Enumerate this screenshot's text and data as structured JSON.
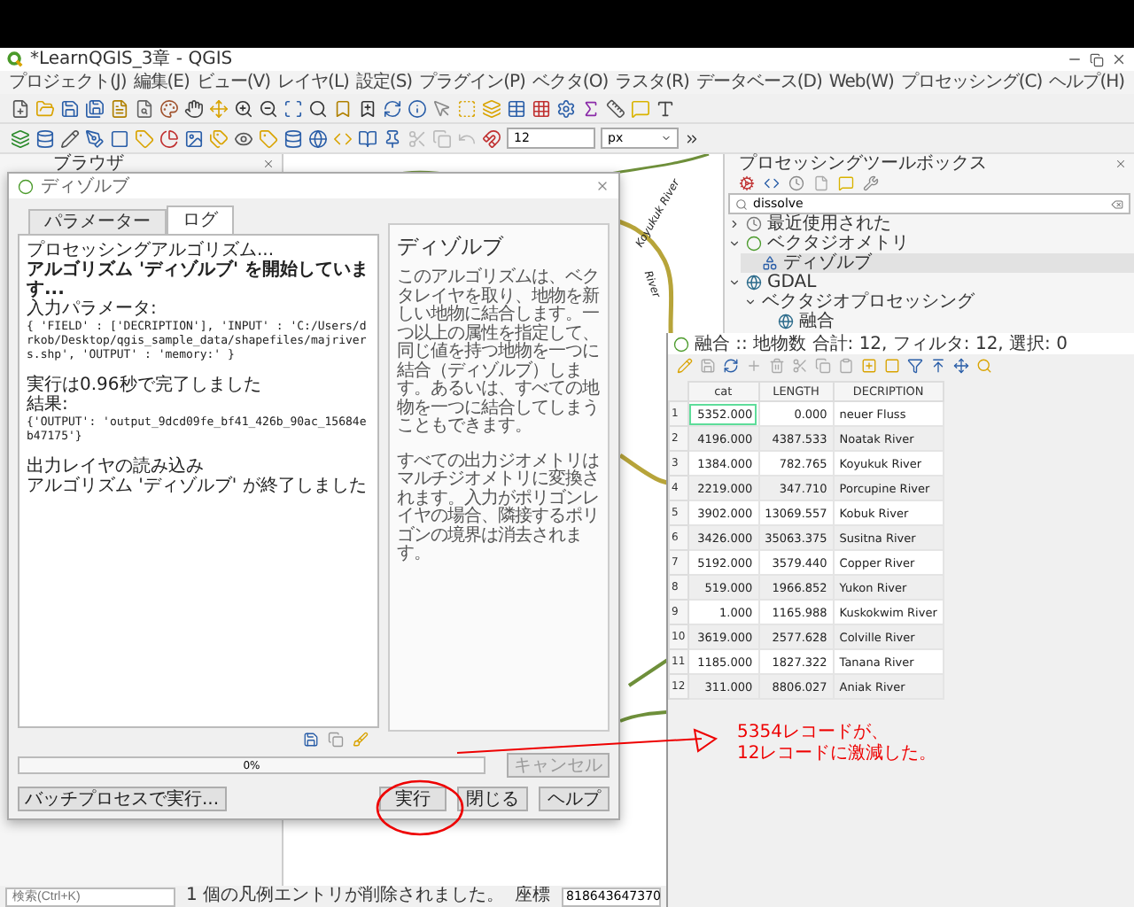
{
  "window": {
    "title": "*LearnQGIS_3章 - QGIS"
  },
  "menu": [
    "プロジェクト(J)",
    "編集(E)",
    "ビュー(V)",
    "レイヤ(L)",
    "設定(S)",
    "プラグイン(P)",
    "ベクタ(O)",
    "ラスタ(R)",
    "データベース(D)",
    "Web(W)",
    "プロセッシング(C)",
    "ヘルプ(H)"
  ],
  "toolbar_font": {
    "size": "12",
    "unit": "px"
  },
  "browser_panel": {
    "title": "ブラウザ"
  },
  "map": {
    "labels": [
      "Koyukuk River",
      "River"
    ]
  },
  "dialog": {
    "title": "ディゾルブ",
    "tabs": [
      {
        "label": "パラメーター",
        "selected": false
      },
      {
        "label": "ログ",
        "selected": true
      }
    ],
    "log": [
      {
        "kind": "text",
        "text": "プロセッシングアルゴリズム...",
        "gap": false
      },
      {
        "kind": "bold",
        "text": "アルゴリズム 'ディゾルブ' を開始しています...",
        "gap": false
      },
      {
        "kind": "text",
        "text": "入力パラメータ:",
        "gap": false
      },
      {
        "kind": "code",
        "text": "{ 'FIELD' : ['DECRIPTION'], 'INPUT' : 'C:/Users/drkob/Desktop/qgis_sample_data/shapefiles/majrivers.shp', 'OUTPUT' : 'memory:' }",
        "gap": false
      },
      {
        "kind": "text",
        "text": "実行は0.96秒で完了しました",
        "gap": true
      },
      {
        "kind": "text",
        "text": "結果:",
        "gap": false
      },
      {
        "kind": "code",
        "text": "{'OUTPUT': 'output_9dcd09fe_bf41_426b_90ac_15684eb47175'}",
        "gap": false
      },
      {
        "kind": "text",
        "text": "出力レイヤの読み込み",
        "gap": true
      },
      {
        "kind": "text",
        "text": "アルゴリズム 'ディゾルブ' が終了しました",
        "gap": false
      }
    ],
    "help": {
      "title": "ディゾルブ",
      "paragraphs": [
        "このアルゴリズムは、ベクタレイヤを取り、地物を新しい地物に結合します。一つ以上の属性を指定して、同じ値を持つ地物を一つに結合（ディゾルブ）します。あるいは、すべての地物を一つに結合してしまうこともできます。",
        "すべての出力ジオメトリはマルチジオメトリに変換されます。入力がポリゴンレイヤの場合、隣接するポリゴンの境界は消去されます。"
      ]
    },
    "progress": {
      "level": 0,
      "text": "0%"
    },
    "cancel": {
      "label": "キャンセル",
      "disabled": true
    },
    "batch": {
      "label": "バッチプロセスで実行..."
    },
    "buttons": [
      {
        "label": "実行",
        "kind": "run"
      },
      {
        "label": "閉じる",
        "kind": "close"
      },
      {
        "label": "ヘルプ",
        "kind": "help"
      }
    ]
  },
  "toolbox": {
    "title": "プロセッシングツールボックス",
    "search": {
      "value": "dissolve"
    },
    "tree": [
      {
        "label": "最近使用された",
        "kind": "recent",
        "expanded": false,
        "selected": false
      },
      {
        "label": "ベクタジオメトリ",
        "kind": "qgis",
        "expanded": true,
        "selected": false,
        "children": [
          {
            "label": "ディゾルブ",
            "kind": "algorithm",
            "selected": true
          }
        ]
      },
      {
        "label": "GDAL",
        "kind": "gdal",
        "expanded": true,
        "selected": false,
        "children": [
          {
            "label": "ベクタジオプロセッシング",
            "kind": "group",
            "expanded": true,
            "selected": false,
            "children": [
              {
                "label": "融合",
                "kind": "gdal_algorithm",
                "selected": false
              }
            ]
          }
        ]
      }
    ]
  },
  "attribute_table": {
    "title": "融合 :: 地物数 合計: 12, フィルタ: 12, 選択: 0",
    "columns": [
      "cat",
      "LENGTH",
      "DECRIPTION"
    ],
    "rows": [
      {
        "number": "1",
        "cells": [
          "5352.000",
          "0.000",
          "neuer Fluss"
        ],
        "current": true
      },
      {
        "number": "2",
        "cells": [
          "4196.000",
          "4387.533",
          "Noatak River"
        ],
        "current": false
      },
      {
        "number": "3",
        "cells": [
          "1384.000",
          "782.765",
          "Koyukuk River"
        ],
        "current": false
      },
      {
        "number": "4",
        "cells": [
          "2219.000",
          "347.710",
          "Porcupine River"
        ],
        "current": false
      },
      {
        "number": "5",
        "cells": [
          "3902.000",
          "13069.557",
          "Kobuk River"
        ],
        "current": false
      },
      {
        "number": "6",
        "cells": [
          "3426.000",
          "35063.375",
          "Susitna River"
        ],
        "current": false
      },
      {
        "number": "7",
        "cells": [
          "5192.000",
          "3579.440",
          "Copper River"
        ],
        "current": false
      },
      {
        "number": "8",
        "cells": [
          "519.000",
          "1966.852",
          "Yukon River"
        ],
        "current": false
      },
      {
        "number": "9",
        "cells": [
          "1.000",
          "1165.988",
          "Kuskokwim River"
        ],
        "current": false
      },
      {
        "number": "10",
        "cells": [
          "3619.000",
          "2577.628",
          "Colville River"
        ],
        "current": false
      },
      {
        "number": "11",
        "cells": [
          "1185.000",
          "1827.322",
          "Tanana River"
        ],
        "current": false
      },
      {
        "number": "12",
        "cells": [
          "311.000",
          "8806.027",
          "Aniak River"
        ],
        "current": false
      }
    ]
  },
  "annotation": {
    "lines": [
      "5354レコードが、",
      "12レコードに激減した。"
    ]
  },
  "status_bar": {
    "search": {
      "placeholder": "検索(Ctrl+K)"
    },
    "message": "1 個の凡例エントリが削除されました。",
    "coordinate_label": "座標",
    "coordinate": "818643647370"
  }
}
